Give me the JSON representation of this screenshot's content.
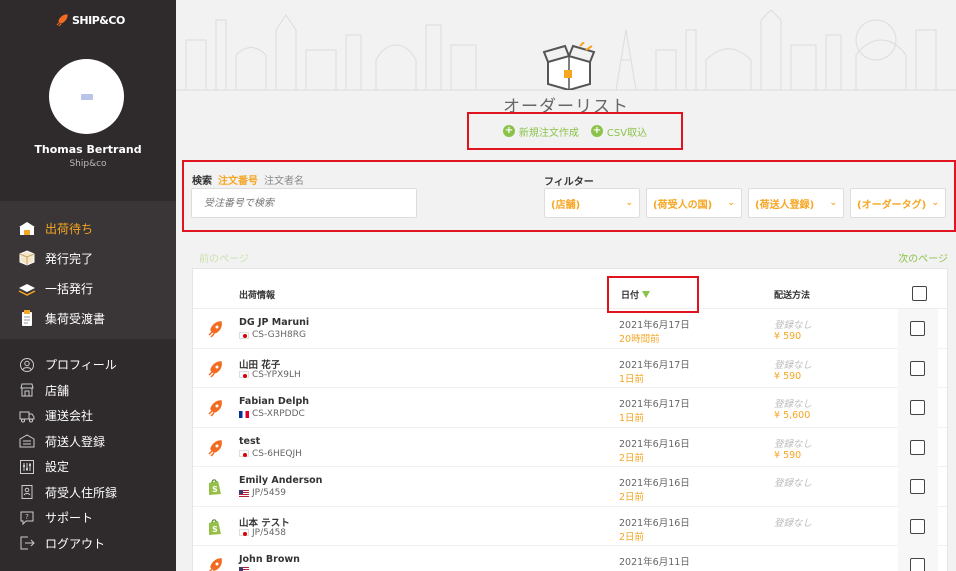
{
  "app": {
    "logo_text": "SHIP&CO"
  },
  "user": {
    "name": "Thomas Bertrand",
    "shop": "Ship&co"
  },
  "nav_primary": [
    {
      "label": "出荷待ち",
      "icon": "warehouse-icon"
    },
    {
      "label": "発行完了",
      "icon": "box-icon"
    },
    {
      "label": "一括発行",
      "icon": "layers-icon"
    },
    {
      "label": "集荷受渡書",
      "icon": "clipboard-icon"
    }
  ],
  "nav_secondary": [
    {
      "label": "プロフィール",
      "icon": "user-icon"
    },
    {
      "label": "店舗",
      "icon": "store-icon"
    },
    {
      "label": "運送会社",
      "icon": "truck-icon"
    },
    {
      "label": "荷送人登録",
      "icon": "building-icon"
    },
    {
      "label": "設定",
      "icon": "sliders-icon"
    },
    {
      "label": "荷受人住所録",
      "icon": "address-book-icon"
    },
    {
      "label": "サポート",
      "icon": "help-icon"
    },
    {
      "label": "ログアウト",
      "icon": "logout-icon"
    }
  ],
  "page": {
    "title": "オーダーリスト",
    "new_order": "新規注文作成",
    "csv_import": "CSV取込"
  },
  "search": {
    "label": "検索",
    "mode_order_number": "注文番号",
    "mode_orderer": "注文者名",
    "placeholder": "受注番号で検索"
  },
  "filter": {
    "label": "フィルター",
    "selects": [
      "(店舗)",
      "(荷受人の国)",
      "(荷送人登録)",
      "(オーダータグ)"
    ]
  },
  "pagination": {
    "prev": "前のページ",
    "next": "次のページ"
  },
  "table": {
    "headers": {
      "shipment": "出荷情報",
      "date": "日付",
      "method": "配送方法"
    },
    "rows": [
      {
        "name": "DG JP Maruni",
        "flag": "jp",
        "code": "CS-G3H8RG",
        "date": "2021年6月17日",
        "relative": "20時間前",
        "method": "登録なし",
        "price": "¥ 590",
        "icon": "rocket-icon"
      },
      {
        "name": "山田 花子",
        "flag": "jp",
        "code": "CS-YPX9LH",
        "date": "2021年6月17日",
        "relative": "1日前",
        "method": "登録なし",
        "price": "¥ 590",
        "icon": "rocket-icon"
      },
      {
        "name": "Fabian Delph",
        "flag": "fr",
        "code": "CS-XRPDDC",
        "date": "2021年6月17日",
        "relative": "1日前",
        "method": "登録なし",
        "price": "¥ 5,600",
        "icon": "rocket-icon"
      },
      {
        "name": "test",
        "flag": "jp",
        "code": "CS-6HEQJH",
        "date": "2021年6月16日",
        "relative": "2日前",
        "method": "登録なし",
        "price": "¥ 590",
        "icon": "rocket-icon"
      },
      {
        "name": "Emily Anderson",
        "flag": "us",
        "code": "JP/5459",
        "date": "2021年6月16日",
        "relative": "2日前",
        "method": "登録なし",
        "price": "",
        "icon": "shopify-icon"
      },
      {
        "name": "山本 テスト",
        "flag": "jp",
        "code": "JP/5458",
        "date": "2021年6月16日",
        "relative": "2日前",
        "method": "登録なし",
        "price": "",
        "icon": "shopify-icon"
      },
      {
        "name": "John Brown",
        "flag": "us",
        "code": "",
        "date": "2021年6月11日",
        "relative": "",
        "method": "",
        "price": "",
        "icon": "rocket-icon"
      }
    ]
  },
  "colors": {
    "sidebar": "#2f2a2b",
    "accent_orange": "#f5a623",
    "accent_green": "#8bc34a",
    "highlight_red": "#e0141e"
  }
}
